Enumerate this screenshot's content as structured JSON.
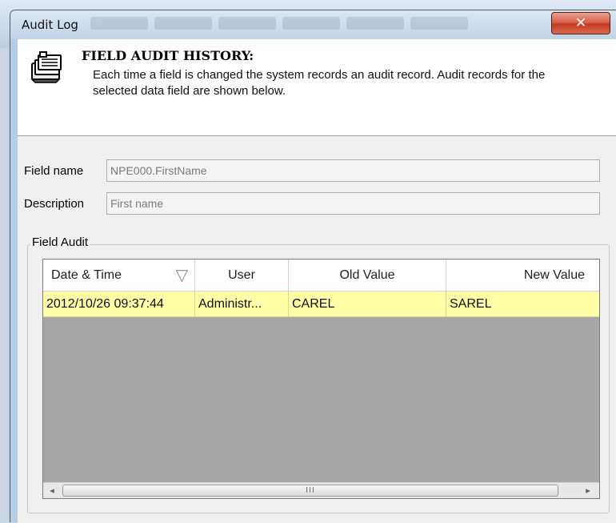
{
  "window": {
    "title": "Audit Log",
    "close_label": "✕"
  },
  "header": {
    "icon": "audit-records-icon",
    "title": "FIELD AUDIT HISTORY:",
    "description": "Each time a field is changed the system records an audit record. Audit records for the selected data field are shown below."
  },
  "fields": {
    "field_name_label": "Field name",
    "field_name_value": "NPE000.FirstName",
    "description_label": "Description",
    "description_value": "First name"
  },
  "field_audit": {
    "group_label": "Field Audit",
    "columns": [
      "Date & Time",
      "User",
      "Old Value",
      "New Value"
    ],
    "sort_indicator": "▽",
    "rows": [
      [
        "2012/10/26 09:37:44",
        "Administr...",
        "CAREL",
        "SAREL"
      ]
    ],
    "scroll_thumb_grip": "III",
    "scroll_left": "◂",
    "scroll_right": "▸"
  },
  "colors": {
    "selected_row": "#ffffa8",
    "grid_empty": "#a7a7a7",
    "close_button": "#c8432a"
  }
}
